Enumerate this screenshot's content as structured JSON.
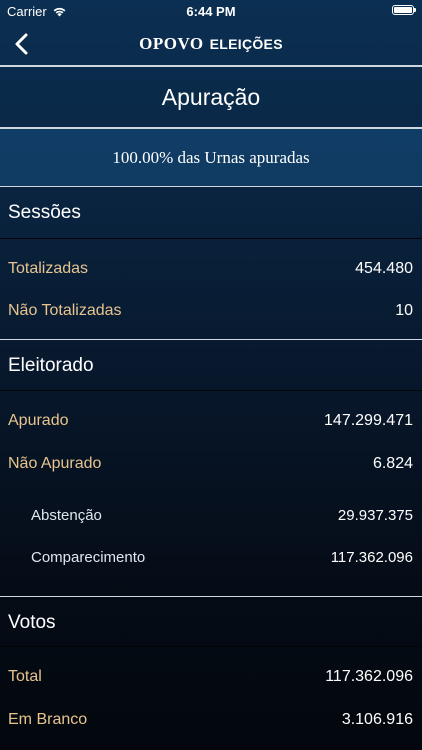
{
  "status_bar": {
    "carrier": "Carrier",
    "time": "6:44 PM"
  },
  "nav": {
    "brand_logo": "OPOVO",
    "brand_section": "ELEIÇÕES"
  },
  "title": "Apuração",
  "progress_text": "100.00% das Urnas apuradas",
  "sessoes": {
    "header": "Sessões",
    "rows": [
      {
        "label": "Totalizadas",
        "value": "454.480"
      },
      {
        "label": "Não Totalizadas",
        "value": "10"
      }
    ]
  },
  "eleitorado": {
    "header": "Eleitorado",
    "rows": [
      {
        "label": "Apurado",
        "value": "147.299.471"
      },
      {
        "label": "Não Apurado",
        "value": "6.824"
      }
    ],
    "sub_rows": [
      {
        "label": "Abstenção",
        "value": "29.937.375"
      },
      {
        "label": "Comparecimento",
        "value": "117.362.096"
      }
    ]
  },
  "votos": {
    "header": "Votos",
    "rows": [
      {
        "label": "Total",
        "value": "117.362.096"
      },
      {
        "label": "Em Branco",
        "value": "3.106.916"
      }
    ]
  }
}
